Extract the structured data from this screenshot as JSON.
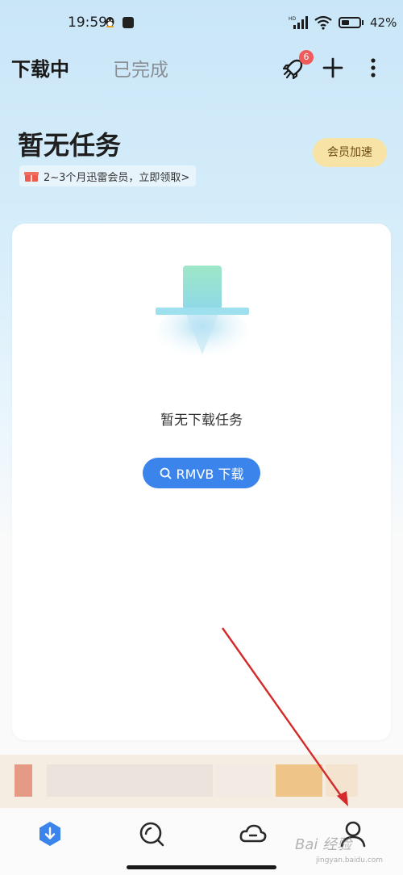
{
  "status_bar": {
    "time": "19:59",
    "battery": "42%",
    "network": "HD"
  },
  "header": {
    "tab_downloading": "下载中",
    "tab_completed": "已完成",
    "notification_count": "6"
  },
  "summary": {
    "title": "暂无任务",
    "promo": "2~3个月迅雷会员，立即领取>",
    "vip_button": "会员加速"
  },
  "card": {
    "empty_text": "暂无下载任务",
    "search_button": "RMVB 下载"
  },
  "watermark": {
    "main": "Bai 经验",
    "sub": "jingyan.baidu.com"
  },
  "colors": {
    "accent": "#3a84ec",
    "vip": "#f7e3a6",
    "badge": "#f05a5a",
    "annotation_arrow": "#d42a2a"
  },
  "icons": [
    "qq-icon",
    "capcut-icon",
    "signal-icon",
    "wifi-icon",
    "battery-icon",
    "rocket-icon",
    "plus-icon",
    "more-icon",
    "gift-icon",
    "search-icon",
    "download-nav-icon",
    "discover-nav-icon",
    "cloud-nav-icon",
    "profile-nav-icon"
  ]
}
